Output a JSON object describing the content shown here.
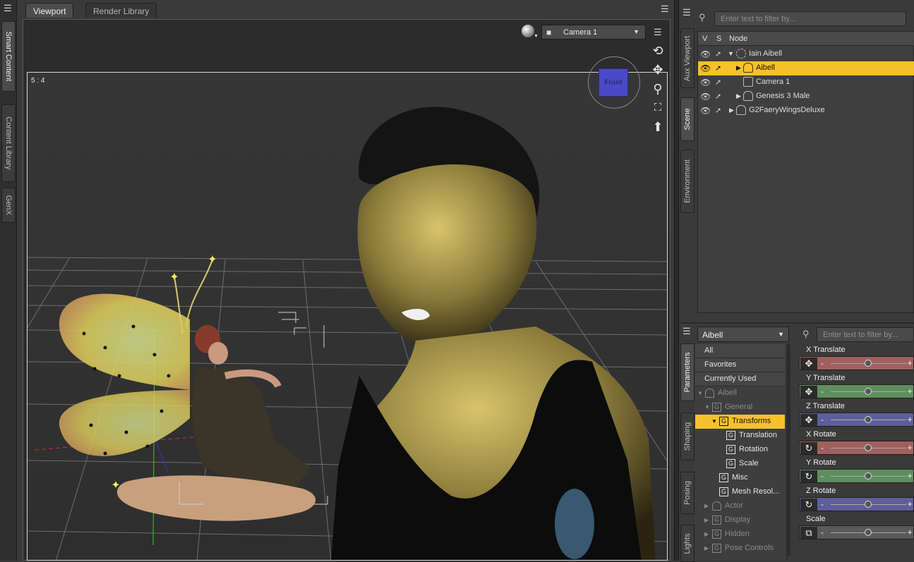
{
  "left_tabs": [
    "Smart Content",
    "Content Library",
    "GenX"
  ],
  "viewport_tabs": [
    "Viewport",
    "Render Library"
  ],
  "viewport": {
    "camera": "Camera 1",
    "aspect_label": "5 : 4",
    "view_cube_label": "Front"
  },
  "scene_tabs": [
    "Aux Viewport",
    "Scene",
    "Environment"
  ],
  "scene": {
    "filter_placeholder": "Enter text to filter by...",
    "columns": [
      "V",
      "S",
      "Node"
    ],
    "nodes": [
      {
        "label": "Iain Aibell",
        "selected": false
      },
      {
        "label": "Aibell",
        "selected": true
      },
      {
        "label": "Camera 1",
        "selected": false
      },
      {
        "label": "Genesis 3 Male",
        "selected": false
      },
      {
        "label": "G2FaeryWingsDeluxe",
        "selected": false
      }
    ]
  },
  "param_tabs": [
    "Parameters",
    "Shaping",
    "Posing",
    "Lights"
  ],
  "parameters": {
    "node_select": "Aibell",
    "filter_placeholder": "Enter text to filter by...",
    "groups": [
      {
        "label": "All"
      },
      {
        "label": "Favorites"
      },
      {
        "label": "Currently Used"
      },
      {
        "label": "Aibell"
      },
      {
        "label": "General"
      },
      {
        "label": "Transforms"
      },
      {
        "label": "Translation"
      },
      {
        "label": "Rotation"
      },
      {
        "label": "Scale"
      },
      {
        "label": "Misc"
      },
      {
        "label": "Mesh Resol..."
      },
      {
        "label": "Actor"
      },
      {
        "label": "Display"
      },
      {
        "label": "Hidden"
      },
      {
        "label": "Pose Controls"
      }
    ],
    "sliders": [
      {
        "name": "X Translate",
        "color": "#a0605e"
      },
      {
        "name": "Y Translate",
        "color": "#5e8f5e"
      },
      {
        "name": "Z Translate",
        "color": "#5e5e9a"
      },
      {
        "name": "X Rotate",
        "color": "#a0605e"
      },
      {
        "name": "Y Rotate",
        "color": "#5e8f5e"
      },
      {
        "name": "Z Rotate",
        "color": "#5e5e9a"
      },
      {
        "name": "Scale",
        "color": "#5a5a5a"
      }
    ]
  }
}
